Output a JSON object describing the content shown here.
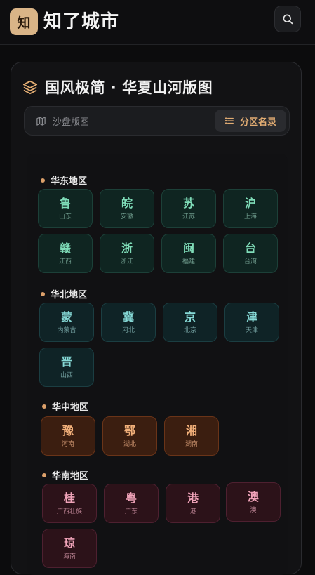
{
  "app": {
    "logo_char": "知",
    "title": "知了城市"
  },
  "card": {
    "title": "国风极简 · 华夏山河版图",
    "tabs": {
      "map_label": "沙盘版图",
      "list_label": "分区名录"
    }
  },
  "colors": {
    "accent": "#e3ad73",
    "green": "#7fdcb8",
    "teal": "#86d9d6",
    "orange": "#f2b07a",
    "red": "#f0a3b9"
  },
  "regions": [
    {
      "name": "华东地区",
      "items": [
        {
          "char": "鲁",
          "name": "山东"
        },
        {
          "char": "皖",
          "name": "安徽"
        },
        {
          "char": "苏",
          "name": "江苏"
        },
        {
          "char": "沪",
          "name": "上海"
        },
        {
          "char": "赣",
          "name": "江西"
        },
        {
          "char": "浙",
          "name": "浙江"
        },
        {
          "char": "闽",
          "name": "福建"
        },
        {
          "char": "台",
          "name": "台湾"
        }
      ]
    },
    {
      "name": "华北地区",
      "items": [
        {
          "char": "蒙",
          "name": "内蒙古"
        },
        {
          "char": "冀",
          "name": "河北"
        },
        {
          "char": "京",
          "name": "北京"
        },
        {
          "char": "津",
          "name": "天津"
        },
        {
          "char": "晋",
          "name": "山西"
        }
      ]
    },
    {
      "name": "华中地区",
      "items": [
        {
          "char": "豫",
          "name": "河南"
        },
        {
          "char": "鄂",
          "name": "湖北"
        },
        {
          "char": "湘",
          "name": "湖南"
        }
      ]
    },
    {
      "name": "华南地区",
      "items": [
        {
          "char": "桂",
          "name": "广西壮族"
        },
        {
          "char": "粤",
          "name": "广东"
        },
        {
          "char": "港",
          "name": "港"
        },
        {
          "char": "澳",
          "name": "澳"
        },
        {
          "char": "琼",
          "name": "海南"
        }
      ]
    }
  ]
}
